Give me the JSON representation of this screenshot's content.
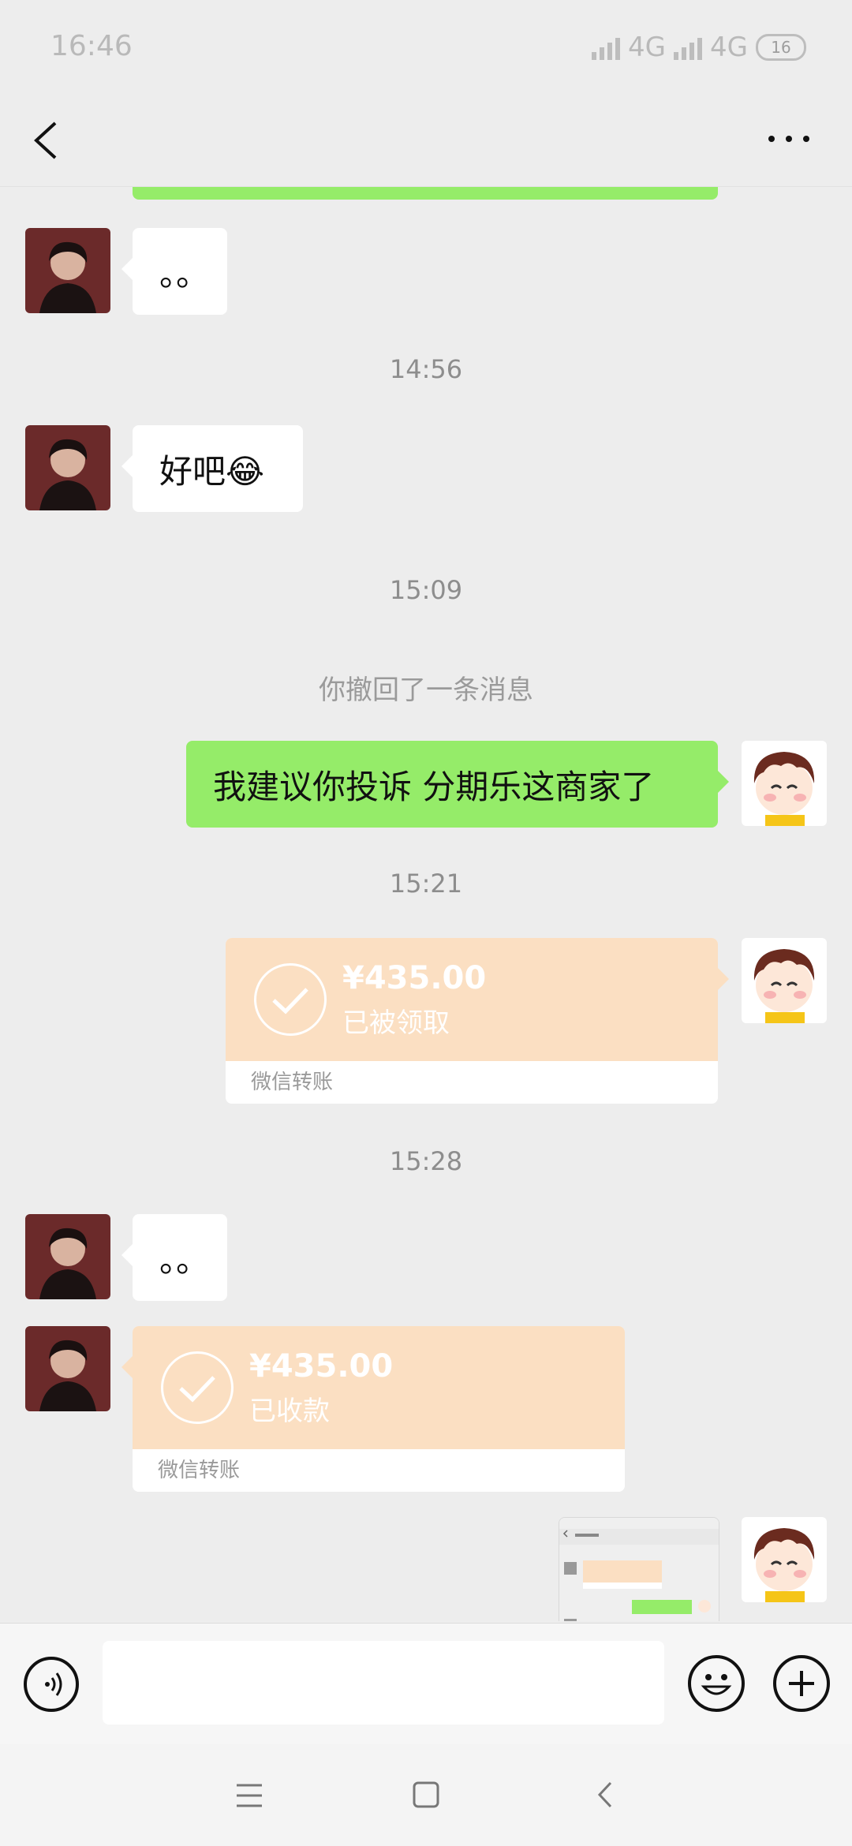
{
  "status_bar": {
    "time": "16:46",
    "network_1": "4G",
    "network_2": "4G",
    "battery": "16"
  },
  "nav": {
    "back_icon": "chevron-left-icon",
    "more_icon": "more-dots-icon"
  },
  "messages": {
    "m1_text": "。。",
    "ts1": "14:56",
    "m2_text": "好吧😂",
    "ts2": "15:09",
    "recall_notice": "你撤回了一条消息",
    "m3_text": "我建议你投诉 分期乐这商家了",
    "ts3": "15:21",
    "transfer1": {
      "amount": "¥435.00",
      "status": "已被领取",
      "label": "微信转账"
    },
    "ts4": "15:28",
    "m4_text": "。。",
    "transfer2": {
      "amount": "¥435.00",
      "status": "已收款",
      "label": "微信转账"
    }
  },
  "input_bar": {
    "voice_icon": "voice-icon",
    "placeholder": "",
    "emoji_icon": "emoji-icon",
    "plus_icon": "plus-icon"
  },
  "colors": {
    "background": "#ededed",
    "outgoing_bubble": "#95ec69",
    "incoming_bubble": "#ffffff",
    "transfer_bg": "#fbdfc2"
  }
}
